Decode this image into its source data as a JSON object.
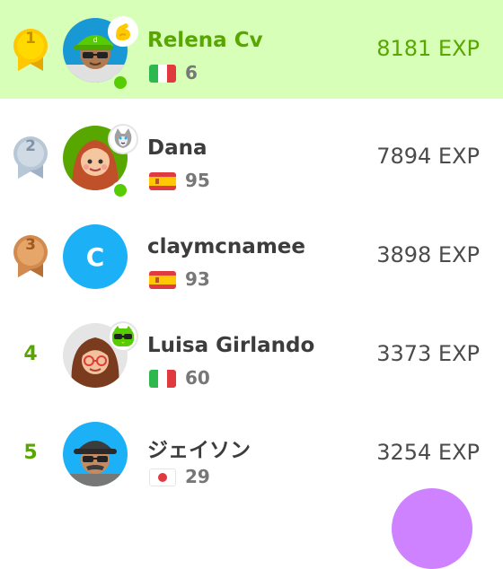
{
  "leaderboard": {
    "rows": [
      {
        "rank": "1",
        "name": "Relena Cv",
        "streak": "6",
        "xp": "8181 EXP",
        "flag": "italy",
        "avatar": "user-avatar-green-cap",
        "badge": "muscle-badge"
      },
      {
        "rank": "2",
        "name": "Dana",
        "streak": "95",
        "xp": "7894 EXP",
        "flag": "spain",
        "avatar": "user-avatar-red-hair",
        "badge": "cat-badge"
      },
      {
        "rank": "3",
        "name": "claymcnamee",
        "streak": "93",
        "xp": "3898 EXP",
        "flag": "spain",
        "avatar": "user-avatar-letter",
        "avatar_letter": "C"
      },
      {
        "rank": "4",
        "name": "Luisa Girlando",
        "streak": "60",
        "xp": "3373 EXP",
        "flag": "italy",
        "avatar": "user-avatar-glasses",
        "badge": "owl-sunglasses-badge"
      },
      {
        "rank": "5",
        "name": "ジェイソン",
        "streak": "29",
        "xp": "3254 EXP",
        "flag": "japan",
        "avatar": "user-avatar-sunglasses-cap"
      }
    ]
  },
  "colors": {
    "highlight": "#d7ffb8",
    "accent_green": "#58a700",
    "gold": "#ffc800",
    "silver": "#b8c7d6",
    "bronze": "#d28a4e",
    "online": "#58cc02",
    "letter_avatar": "#1cb0f6",
    "fab": "#ce82ff"
  }
}
